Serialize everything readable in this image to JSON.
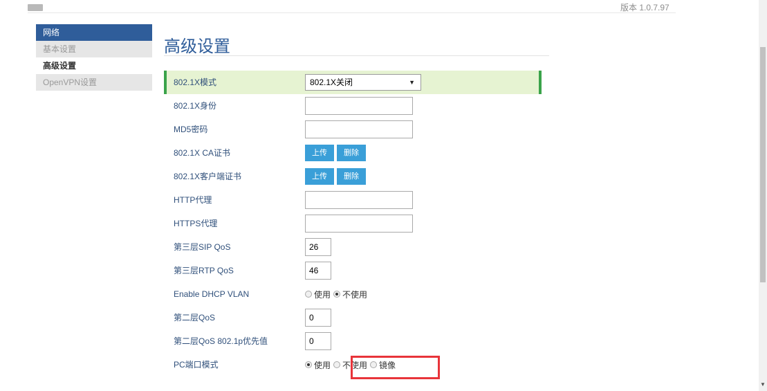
{
  "header": {
    "version": "版本 1.0.7.97",
    "logo_icon": "logo-icon"
  },
  "sidebar": {
    "section": "网络",
    "items": [
      {
        "label": "基本设置",
        "active": false
      },
      {
        "label": "高级设置",
        "active": true
      },
      {
        "label": "OpenVPN设置",
        "active": false
      }
    ]
  },
  "page": {
    "title": "高级设置"
  },
  "form": {
    "dot1x_mode": {
      "label": "802.1X模式",
      "value": "802.1X关闭"
    },
    "dot1x_identity": {
      "label": "802.1X身份",
      "value": ""
    },
    "md5_password": {
      "label": "MD5密码",
      "value": ""
    },
    "dot1x_ca_cert": {
      "label": "802.1X CA证书",
      "upload": "上传",
      "delete": "删除"
    },
    "dot1x_client_cert": {
      "label": "802.1X客户端证书",
      "upload": "上传",
      "delete": "删除"
    },
    "http_proxy": {
      "label": "HTTP代理",
      "value": ""
    },
    "https_proxy": {
      "label": "HTTPS代理",
      "value": ""
    },
    "l3_sip_qos": {
      "label": "第三层SIP QoS",
      "value": "26"
    },
    "l3_rtp_qos": {
      "label": "第三层RTP QoS",
      "value": "46"
    },
    "dhcp_vlan": {
      "label": "Enable DHCP VLAN",
      "options": [
        "使用",
        "不使用"
      ],
      "selected": "不使用"
    },
    "l2_qos": {
      "label": "第二层QoS",
      "value": "0"
    },
    "l2_qos_8021p": {
      "label": "第二层QoS 802.1p优先值",
      "value": "0"
    },
    "pc_port_mode": {
      "label": "PC端口模式",
      "options": [
        "使用",
        "不使用",
        "镜像"
      ],
      "selected": "使用"
    }
  },
  "colors": {
    "brand": "#2f5d9a",
    "highlight_row": "#e6f3d2",
    "highlight_border": "#3aa34a",
    "button": "#3a9fd8",
    "annotation": "#e8343a"
  }
}
